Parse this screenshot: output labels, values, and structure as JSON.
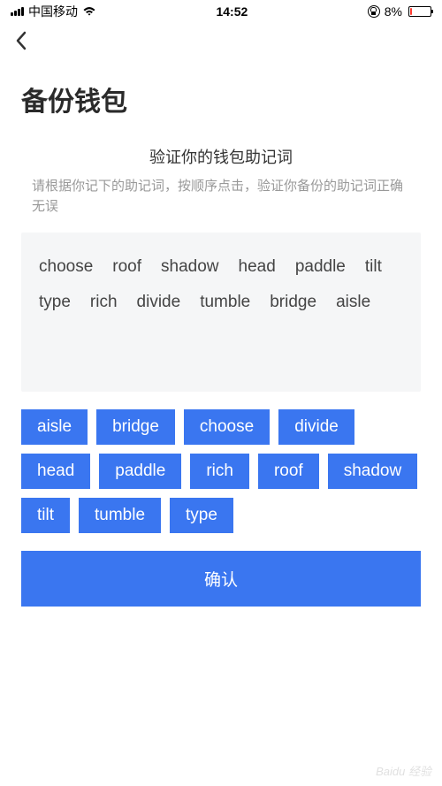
{
  "status_bar": {
    "carrier": "中国移动",
    "time": "14:52",
    "battery_percent": "8%"
  },
  "page": {
    "title": "备份钱包",
    "instruction_title": "验证你的钱包助记词",
    "instruction_subtitle": "请根据你记下的助记词，按顺序点击，验证你备份的助记词正确无误"
  },
  "selected_words": [
    "choose",
    "roof",
    "shadow",
    "head",
    "paddle",
    "tilt",
    "type",
    "rich",
    "divide",
    "tumble",
    "bridge",
    "aisle"
  ],
  "word_pool": [
    "aisle",
    "bridge",
    "choose",
    "divide",
    "head",
    "paddle",
    "rich",
    "roof",
    "shadow",
    "tilt",
    "tumble",
    "type"
  ],
  "confirm_label": "确认",
  "watermark": "Baidu 经验"
}
